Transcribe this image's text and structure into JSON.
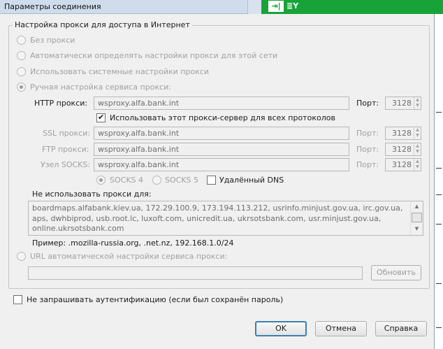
{
  "window": {
    "title": "Параметры соединения",
    "toolbar_icon1": "⇥|",
    "toolbar_icon2": "≣Y"
  },
  "group": {
    "label": "Настройка прокси для доступа в Интернет"
  },
  "modes": {
    "no_proxy": "Без прокси",
    "auto_detect": "Автоматически определять настройки прокси для этой сети",
    "system": "Использовать системные настройки прокси",
    "manual": "Ручная настройка сервиса прокси:",
    "selected": "manual"
  },
  "manual": {
    "http_label": "HTTP прокси:",
    "http_value": "wsproxy.alfa.bank.int",
    "http_port": "3128",
    "use_for_all_label": "Использовать этот прокси-сервер для всех протоколов",
    "use_for_all_checked": true,
    "ssl_label": "SSL прокси:",
    "ssl_value": "wsproxy.alfa.bank.int",
    "ssl_port": "3128",
    "ftp_label": "FTP прокси:",
    "ftp_value": "wsproxy.alfa.bank.int",
    "ftp_port": "3128",
    "socks_label": "Узел SOCKS:",
    "socks_value": "wsproxy.alfa.bank.int",
    "socks_port": "3128",
    "port_label": "Порт:",
    "socks4_label": "SOCKS 4",
    "socks5_label": "SOCKS 5",
    "socks_selected": "socks4",
    "remote_dns_label": "Удалённый DNS",
    "remote_dns_checked": false
  },
  "no_proxy": {
    "label": "Не использовать прокси для:",
    "value": "boardmaps.alfabank.kiev.ua, 172.29.100.9, 173.194.113.212, usrinfo.minjust.gov.ua, irc.gov.ua, aps, dwhbiprod, usb.root.lc, luxoft.com, unicredit.ua, ukrsotsbank.com, usr.minjust.gov.ua, online.ukrsotsbank.com",
    "example": "Пример: .mozilla-russia.org, .net.nz, 192.168.1.0/24"
  },
  "pac": {
    "label": "URL автоматической настройки сервиса прокси:",
    "value": "",
    "reload_label": "Обновить"
  },
  "auth": {
    "label": "Не запрашивать аутентификацию (если был сохранён пароль)",
    "checked": false
  },
  "buttons": {
    "ok": "OK",
    "cancel": "Отмена",
    "help": "Справка"
  },
  "colors": {
    "accent_green": "#17a338",
    "titlebar": "#cfdcec",
    "dialog_bg": "#f0f0f0",
    "primary_border": "#3c7fb1"
  }
}
